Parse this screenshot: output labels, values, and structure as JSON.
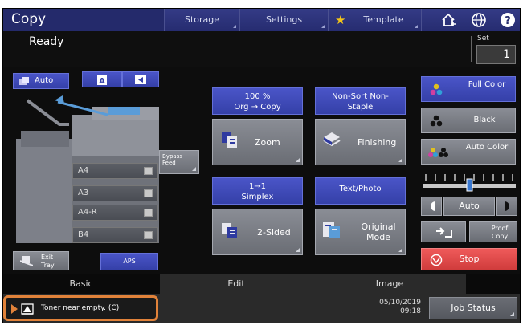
{
  "topbar": {
    "title": "Copy",
    "tabs": [
      "Storage",
      "Settings",
      "Template"
    ],
    "icons": [
      "home-add-icon",
      "globe-icon",
      "help-icon"
    ]
  },
  "status": {
    "ready": "Ready",
    "set_label": "Set",
    "set_value": "1"
  },
  "source": {
    "auto_label": "Auto",
    "aps_label": "APS",
    "bypass_label": "Bypass Feed",
    "exit_tray_label": "Exit Tray",
    "trays": [
      "A4",
      "A3",
      "A4-R",
      "B4"
    ]
  },
  "zoom": {
    "ratio": "100 %",
    "org_copy": "Org  →  Copy",
    "label": "Zoom"
  },
  "finishing": {
    "mode": "Non-Sort Non-Staple",
    "label": "Finishing"
  },
  "sided": {
    "mode": "1→1 Simplex",
    "label": "2-Sided"
  },
  "original": {
    "mode": "Text/Photo",
    "label": "Original Mode"
  },
  "color": {
    "full": "Full Color",
    "black": "Black",
    "auto": "Auto Color",
    "density_label": "Auto",
    "proof": "Proof Copy",
    "stop": "Stop"
  },
  "tabs": [
    "Basic",
    "Edit",
    "Image"
  ],
  "footer": {
    "message": "Toner near empty. (C)",
    "date": "05/10/2019",
    "time": "09:18",
    "job_status": "Job Status"
  },
  "colors": {
    "accent": "#3a45b8",
    "stop": "#e24a4a",
    "highlight": "#e1823a"
  }
}
